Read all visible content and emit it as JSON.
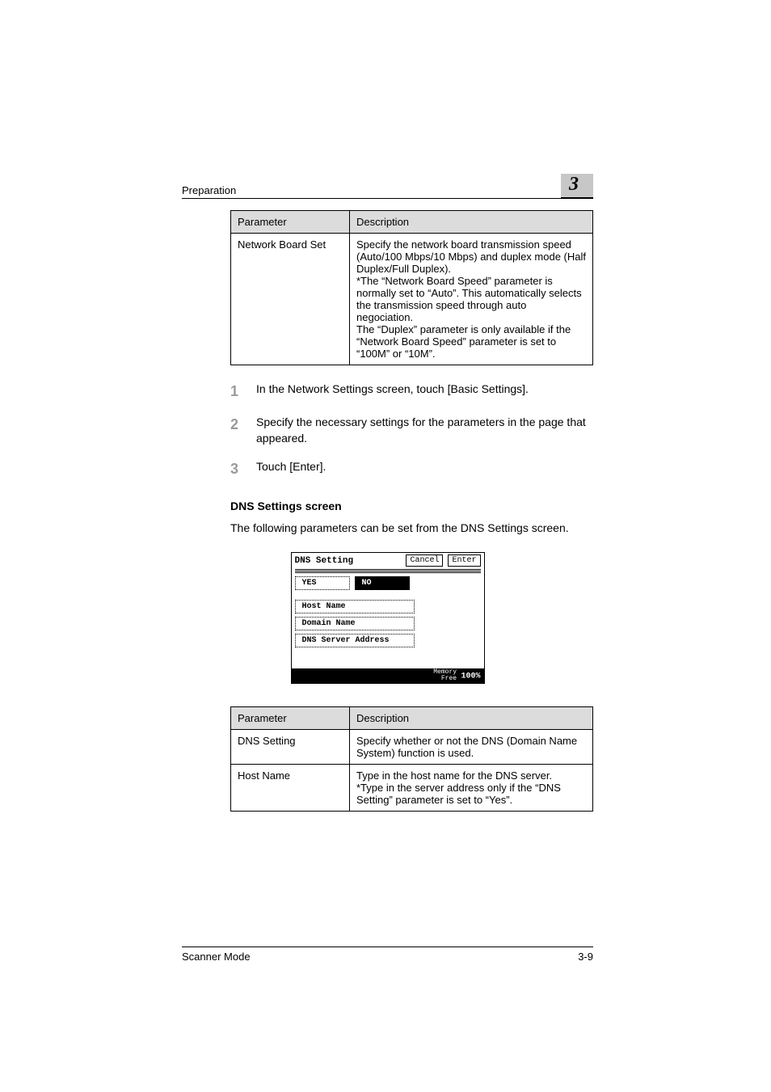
{
  "header": {
    "section": "Preparation",
    "chapter": "3"
  },
  "table1": {
    "headers": {
      "param": "Parameter",
      "desc": "Description"
    },
    "rows": [
      {
        "param": "Network Board Set",
        "desc": "Specify the network board transmission speed (Auto/100 Mbps/10 Mbps) and duplex mode (Half Duplex/Full Duplex).\n*The “Network Board Speed” parameter is normally set to “Auto”. This automatically selects the transmission speed through auto negociation.\nThe “Duplex” parameter is only available if the “Network Board Speed” parameter is set to “100M” or “10M”."
      }
    ]
  },
  "steps": [
    "In the Network Settings screen, touch [Basic Settings].",
    "Specify the necessary settings for the parameters in the page that appeared.",
    "Touch [Enter]."
  ],
  "subheading": "DNS Settings screen",
  "body": "The following parameters can be set from the DNS Settings screen.",
  "lcd": {
    "title": "DNS Setting",
    "cancel": "Cancel",
    "enter": "Enter",
    "yes": "YES",
    "no": "NO",
    "hostName": "Host Name",
    "domainName": "Domain Name",
    "dnsServer": "DNS Server Address",
    "memoryLabel": "Memory\nFree",
    "memoryValue": "100%"
  },
  "table2": {
    "headers": {
      "param": "Parameter",
      "desc": "Description"
    },
    "rows": [
      {
        "param": "DNS Setting",
        "desc": "Specify whether or not the DNS (Domain Name System) function is used."
      },
      {
        "param": "Host Name",
        "desc": "Type in the host name for the DNS server.\n*Type in the server address only if the “DNS Setting” parameter is set to “Yes”."
      }
    ]
  },
  "footer": {
    "left": "Scanner Mode",
    "right": "3-9"
  }
}
